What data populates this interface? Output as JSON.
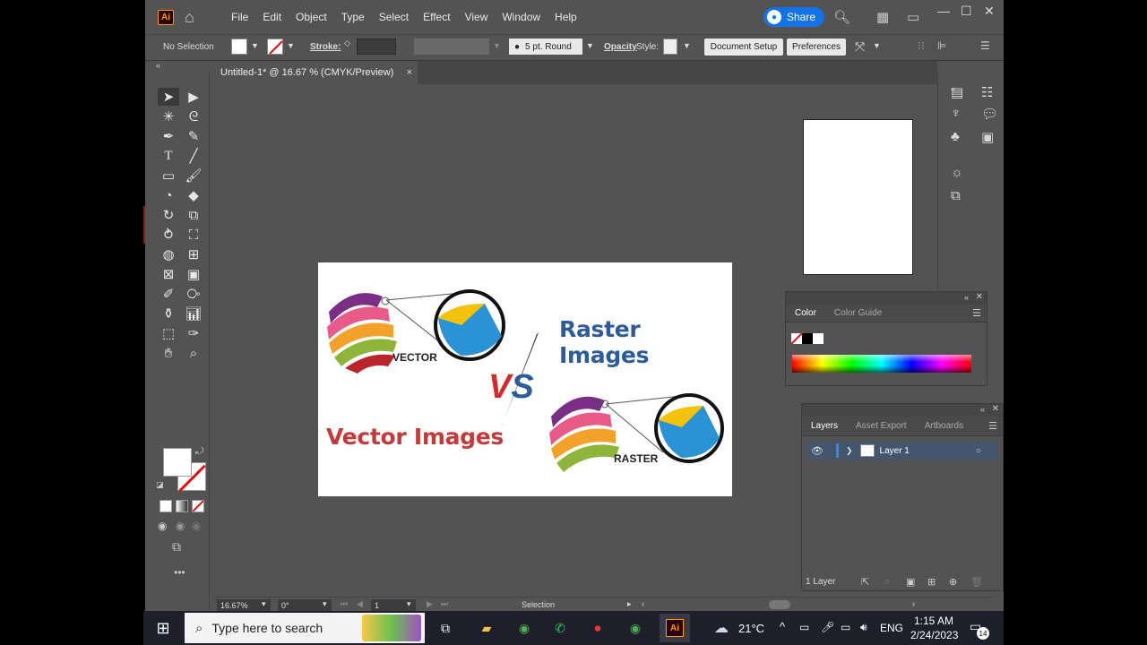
{
  "app": {
    "logo": "Ai",
    "menu": [
      "File",
      "Edit",
      "Object",
      "Type",
      "Select",
      "Effect",
      "View",
      "Window",
      "Help"
    ],
    "share_label": "Share"
  },
  "controlbar": {
    "selection": "No Selection",
    "stroke_label": "Stroke:",
    "brush": "5 pt. Round",
    "opacity_label": "Opacity",
    "style_label": "Style:",
    "document_setup": "Document Setup",
    "preferences": "Preferences"
  },
  "document": {
    "tab_title": "Untitled-1* @ 16.67 % (CMYK/Preview)",
    "close": "×"
  },
  "artwork": {
    "raster_title": "Raster Images",
    "vector_title": "Vector Images",
    "vector_label": "VECTOR",
    "raster_label": "RASTER",
    "vs_v": "V",
    "vs_s": "S"
  },
  "color_panel": {
    "tabs": [
      "Color",
      "Color Guide"
    ]
  },
  "layers_panel": {
    "tabs": [
      "Layers",
      "Asset Export",
      "Artboards"
    ],
    "layer_name": "Layer 1",
    "footer": "1 Layer"
  },
  "statusbar": {
    "zoom": "16.67%",
    "rotation": "0°",
    "artboard": "1",
    "tool": "Selection"
  },
  "taskbar": {
    "search_placeholder": "Type here to search",
    "temperature": "21°C",
    "language": "ENG",
    "time": "1:15 AM",
    "date": "2/24/2023",
    "notifications": "14"
  },
  "colors": {
    "accent_blue": "#1473e6",
    "raster_blue": "#2e5b9a",
    "vector_red": "#c23a3a"
  }
}
